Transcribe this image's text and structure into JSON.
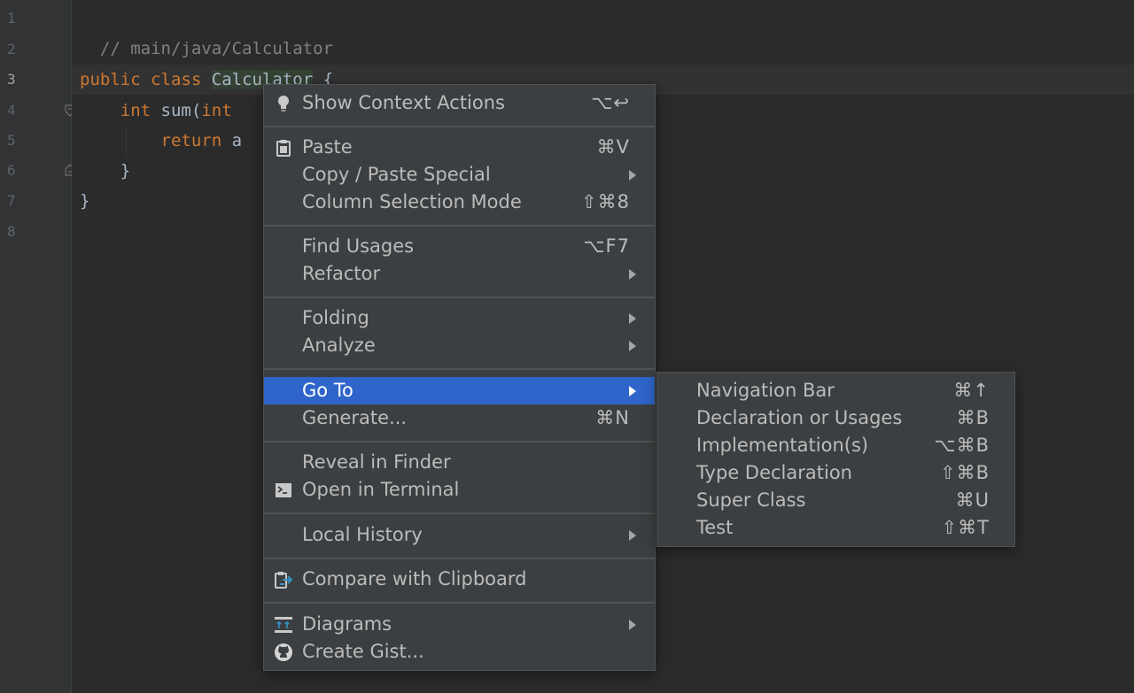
{
  "editor": {
    "line_numbers": [
      "1",
      "2",
      "3",
      "4",
      "5",
      "6",
      "7",
      "8"
    ],
    "lines": {
      "l1_comment": "// main/java/Calculator",
      "l3_public": "public",
      "l3_class": "class",
      "l3_name": "Calculator",
      "l3_brace": "{",
      "l4_type": "int",
      "l4_fn": "sum(",
      "l4_param": "int",
      "l5_return": "return",
      "l5_rest": "a",
      "l6_brace": "}",
      "l7_brace": "}"
    }
  },
  "context_menu": {
    "items": [
      {
        "label": "Show Context Actions",
        "shortcut": "⌥↩",
        "icon": "lightbulb-icon"
      },
      {
        "label": "Paste",
        "shortcut": "⌘V",
        "icon": "clipboard-icon"
      },
      {
        "label": "Copy / Paste Special",
        "submenu": true
      },
      {
        "label": "Column Selection Mode",
        "shortcut": "⇧⌘8"
      },
      {
        "label": "Find Usages",
        "shortcut": "⌥F7"
      },
      {
        "label": "Refactor",
        "submenu": true
      },
      {
        "label": "Folding",
        "submenu": true
      },
      {
        "label": "Analyze",
        "submenu": true
      },
      {
        "label": "Go To",
        "submenu": true,
        "selected": true
      },
      {
        "label": "Generate...",
        "shortcut": "⌘N"
      },
      {
        "label": "Reveal in Finder"
      },
      {
        "label": "Open in Terminal",
        "icon": "terminal-icon"
      },
      {
        "label": "Local History",
        "submenu": true
      },
      {
        "label": "Compare with Clipboard",
        "icon": "compare-clipboard-icon"
      },
      {
        "label": "Diagrams",
        "submenu": true,
        "icon": "diagram-icon"
      },
      {
        "label": "Create Gist...",
        "icon": "github-icon"
      }
    ]
  },
  "goto_submenu": {
    "items": [
      {
        "label": "Navigation Bar",
        "shortcut": "⌘↑"
      },
      {
        "label": "Declaration or Usages",
        "shortcut": "⌘B"
      },
      {
        "label": "Implementation(s)",
        "shortcut": "⌥⌘B"
      },
      {
        "label": "Type Declaration",
        "shortcut": "⇧⌘B"
      },
      {
        "label": "Super Class",
        "shortcut": "⌘U"
      },
      {
        "label": "Test",
        "shortcut": "⇧⌘T"
      }
    ]
  },
  "colors": {
    "background": "#2b2b2b",
    "keyword": "#cc7832",
    "comment": "#808080",
    "menu_bg": "#3c3f41",
    "selection": "#2f65ca",
    "text": "#bbbbbb"
  }
}
